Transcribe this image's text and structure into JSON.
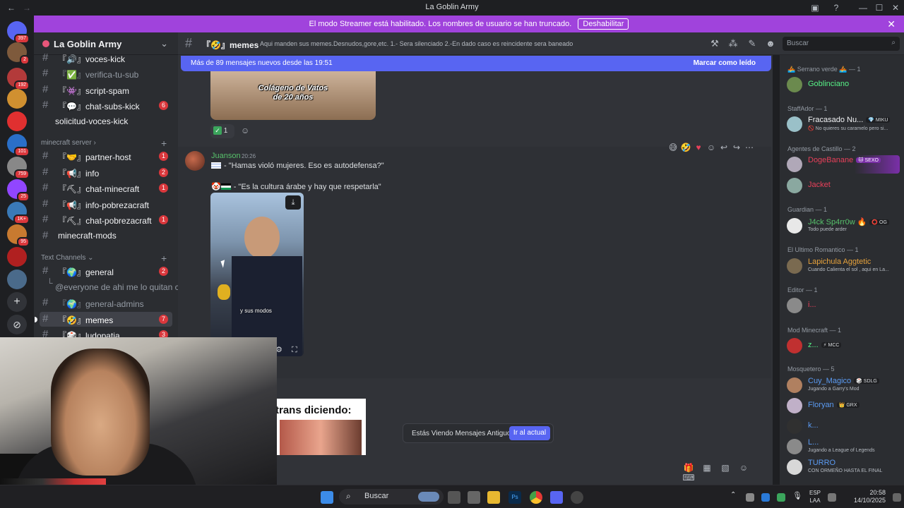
{
  "window": {
    "title": "La Goblin Army"
  },
  "banner": {
    "text": "El modo Streamer está habilitado. Los nombres de usuario se han truncado.",
    "button": "Deshabilitar"
  },
  "server_list": {
    "badges": [
      "397",
      "2",
      "192",
      "101",
      "759",
      "25",
      "1K+",
      "95"
    ]
  },
  "guild": {
    "name": "La Goblin Army"
  },
  "channels": [
    {
      "label": "『🔊』voces-kick",
      "unread": true,
      "badge": ""
    },
    {
      "label": "『✅』verifica-tu-sub",
      "unread": false,
      "badge": ""
    },
    {
      "label": "『👾』script-spam",
      "unread": true,
      "badge": ""
    },
    {
      "label": "『💬』chat-subs-kick",
      "unread": true,
      "badge": "6"
    },
    {
      "label": "solicitud-voces-kick",
      "unread": true,
      "badge": ""
    }
  ],
  "category_minecraft": "minecraft server",
  "mc_channels": [
    {
      "label": "『🤝』partner-host",
      "badge": "1"
    },
    {
      "label": "『📢』info",
      "badge": "2"
    },
    {
      "label": "『⛏』chat-minecraft",
      "badge": "1"
    },
    {
      "label": "『📢』info-pobrezacraft",
      "badge": ""
    },
    {
      "label": "『⛏』chat-pobrezacraft",
      "badge": "1"
    },
    {
      "label": "minecraft-mods",
      "badge": ""
    }
  ],
  "category_text": "Text Channels",
  "text_channels": [
    {
      "label": "『🌍』general",
      "badge": "2"
    },
    {
      "label": "@everyone de ahi me lo quitan ch...",
      "badge": ""
    },
    {
      "label": "『🌍』general-admins",
      "badge": ""
    },
    {
      "label": "『🤣』memes",
      "badge": "7"
    },
    {
      "label": "『🎲』ludopatia",
      "badge": "3"
    }
  ],
  "header": {
    "channel": "『🤣』memes",
    "topic": "Aqui manden sus memes.Desnudos,gore,etc. 1.- Sera silenciado 2.-En dado caso es reincidente sera baneado",
    "search_placeholder": "Buscar"
  },
  "new_messages": {
    "text": "Más de 89 mensajes nuevos desde las 19:51",
    "action": "Marcar como leído"
  },
  "meme1": {
    "caption": "Colágeno de Vatos de 20 años",
    "reaction_count": "1"
  },
  "message": {
    "author": "Juanson",
    "time": "20:26",
    "line1": "- \"Hamas violó mujeres. Eso es autodefensa?\"",
    "line2": "- \"Es la cultura árabe y hay que respetarla\"",
    "video_subtitle": "y sus modos"
  },
  "meme2": {
    "caption": "trans diciendo:"
  },
  "old_messages": {
    "text": "Estás Viendo Mensajes Antiguos",
    "button": "Ir al actual"
  },
  "members": {
    "groups": [
      {
        "title": "🚣 Serrano verde 🚣 — 1",
        "items": [
          {
            "name": "Goblinciano",
            "color": "#57f287",
            "status": "",
            "tag": ""
          }
        ]
      },
      {
        "title": "StaffAdor — 1",
        "items": [
          {
            "name": "Fracasado Nu...",
            "color": "#f2f3f5",
            "status": "🚫 No quieres su caramelo pero si...",
            "tag": "💎 MIKU"
          }
        ]
      },
      {
        "title": "Agentes de Castillo — 2",
        "items": [
          {
            "name": "DogeBanane",
            "color": "#e8405a",
            "status": "",
            "tag": "🐱 SEXO"
          },
          {
            "name": "Jacket",
            "color": "#e8405a",
            "status": "",
            "tag": ""
          }
        ]
      },
      {
        "title": "Guardian — 1",
        "items": [
          {
            "name": "J4ck Sp4rr0w 🔥",
            "color": "#57c16b",
            "status": "Todo puede arder",
            "tag": "⭕ OG"
          }
        ]
      },
      {
        "title": "El Ultimo Romantico — 1",
        "items": [
          {
            "name": "Lapichula Aggtetic",
            "color": "#e6a23c",
            "status": "Cuando Calienta el sol , aqui en La...",
            "tag": ""
          }
        ]
      },
      {
        "title": "Editor — 1",
        "items": [
          {
            "name": "i...",
            "color": "#e8405a",
            "status": "",
            "tag": ""
          }
        ]
      },
      {
        "title": "Mod Minecraft — 1",
        "items": [
          {
            "name": "z...",
            "color": "#57f287",
            "status": "",
            "tag": "⚡ MCC"
          }
        ]
      },
      {
        "title": "Mosquetero — 5",
        "items": [
          {
            "name": "Cuy_Magico",
            "color": "#5b9bf2",
            "status": "Jugando a Garry's Mod",
            "tag": "🎲 SDLG"
          },
          {
            "name": "Floryan",
            "color": "#5b9bf2",
            "status": "",
            "tag": "👑 GRX"
          },
          {
            "name": "k...",
            "color": "#5b9bf2",
            "status": "",
            "tag": ""
          },
          {
            "name": "L...",
            "color": "#5b9bf2",
            "status": "Jugando a League of Legends",
            "tag": ""
          },
          {
            "name": "TURRO",
            "color": "#5b9bf2",
            "status": "CON ORMEÑO HASTA EL FINAL",
            "tag": ""
          }
        ]
      }
    ]
  },
  "taskbar": {
    "search": "Buscar",
    "lang1": "ESP",
    "lang2": "LAA",
    "time": "20:58",
    "date": "14/10/2025"
  }
}
